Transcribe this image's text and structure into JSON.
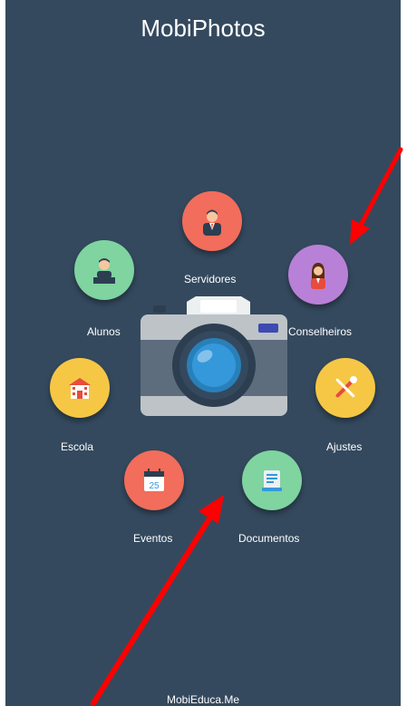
{
  "app": {
    "title": "MobiPhotos",
    "footer": "MobiEduca.Me"
  },
  "menu": {
    "servidores": {
      "label": "Servidores",
      "color": "#f26d5b",
      "icon": "staff-person-icon"
    },
    "conselheiros": {
      "label": "Conselheiros",
      "color": "#b980d8",
      "icon": "counselor-woman-icon"
    },
    "alunos": {
      "label": "Alunos",
      "color": "#7fd4a0",
      "icon": "student-icon"
    },
    "escola": {
      "label": "Escola",
      "color": "#f6c744",
      "icon": "school-building-icon"
    },
    "ajustes": {
      "label": "Ajustes",
      "color": "#f6c744",
      "icon": "wrench-screwdriver-icon"
    },
    "eventos": {
      "label": "Eventos",
      "color": "#f26d5b",
      "icon": "calendar-icon",
      "calendar_day": "25"
    },
    "documentos": {
      "label": "Documentos",
      "color": "#7fd4a0",
      "icon": "document-icon"
    }
  },
  "center": {
    "icon": "camera-icon"
  },
  "annotations": {
    "arrow_color": "#ff0000"
  }
}
